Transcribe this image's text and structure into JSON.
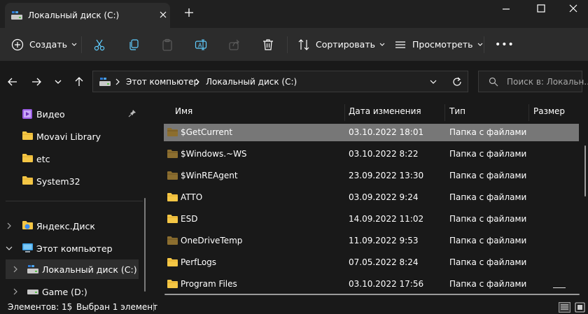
{
  "window": {
    "tab_title": "Локальный диск (C:)"
  },
  "toolbar": {
    "create_label": "Создать",
    "sort_label": "Сортировать",
    "view_label": "Просмотреть",
    "more_label": "•••"
  },
  "address": {
    "crumbs": [
      "Этот компьютер",
      "Локальный диск (C:)"
    ],
    "search_placeholder": "Поиск в: Локальн..."
  },
  "nav": {
    "quick_access": [
      {
        "label": "Видео",
        "icon": "video-folder-icon",
        "pinned": true
      },
      {
        "label": "Movavi Library",
        "icon": "folder-icon"
      },
      {
        "label": "etc",
        "icon": "folder-icon"
      },
      {
        "label": "System32",
        "icon": "folder-icon"
      }
    ],
    "tree": [
      {
        "label": "Яндекс.Диск",
        "icon": "yandex-disk-icon",
        "expanded": false
      },
      {
        "label": "Этот компьютер",
        "icon": "computer-icon",
        "expanded": true
      },
      {
        "label": "Локальный диск (C:)",
        "icon": "drive-c-icon",
        "expanded": false,
        "selected": true
      },
      {
        "label": "Game (D:)",
        "icon": "drive-icon",
        "expanded": false
      }
    ]
  },
  "columns": {
    "name": "Имя",
    "date": "Дата изменения",
    "type": "Тип",
    "size": "Размер"
  },
  "files": [
    {
      "name": "$GetCurrent",
      "date": "03.10.2022 18:01",
      "type": "Папка с файлами",
      "hidden": true,
      "selected": true
    },
    {
      "name": "$Windows.~WS",
      "date": "03.10.2022 8:22",
      "type": "Папка с файлами",
      "hidden": true
    },
    {
      "name": "$WinREAgent",
      "date": "23.09.2022 13:30",
      "type": "Папка с файлами",
      "hidden": true
    },
    {
      "name": "ATTO",
      "date": "03.09.2022 9:24",
      "type": "Папка с файлами",
      "hidden": false
    },
    {
      "name": "ESD",
      "date": "14.09.2022 11:02",
      "type": "Папка с файлами",
      "hidden": false
    },
    {
      "name": "OneDriveTemp",
      "date": "11.09.2022 9:53",
      "type": "Папка с файлами",
      "hidden": true
    },
    {
      "name": "PerfLogs",
      "date": "07.05.2022 8:24",
      "type": "Папка с файлами",
      "hidden": false
    },
    {
      "name": "Program Files",
      "date": "03.10.2022 17:56",
      "type": "Папка с файлами",
      "hidden": false
    }
  ],
  "status": {
    "items_count": "Элементов: 15",
    "selected": "Выбран 1 элемент"
  },
  "colors": {
    "folder": "#f4c645",
    "folder_hidden": "#8c6e2f",
    "selection": "#777777",
    "background": "#191919",
    "toolbar": "#2c2c2c"
  }
}
